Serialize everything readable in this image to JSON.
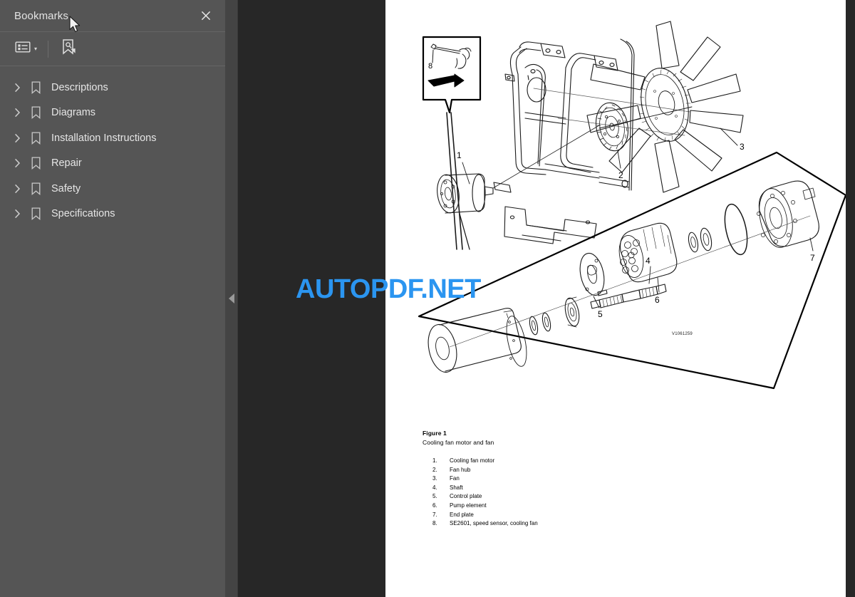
{
  "sidebar": {
    "title": "Bookmarks",
    "close_label": "×",
    "close_icon": "close-icon",
    "toolbar": {
      "list_options_icon": "list-options-icon",
      "list_options_caret": "▾",
      "find_bookmark_icon": "find-bookmark-icon"
    },
    "items": [
      {
        "label": "Descriptions",
        "chevron": "›",
        "icon": "bookmark-icon"
      },
      {
        "label": "Diagrams",
        "chevron": "›",
        "icon": "bookmark-icon"
      },
      {
        "label": "Installation Instructions",
        "chevron": "›",
        "icon": "bookmark-icon"
      },
      {
        "label": "Repair",
        "chevron": "›",
        "icon": "bookmark-icon"
      },
      {
        "label": "Safety",
        "chevron": "›",
        "icon": "bookmark-icon"
      },
      {
        "label": "Specifications",
        "chevron": "›",
        "icon": "bookmark-icon"
      }
    ]
  },
  "collapse_handle": {
    "icon": "collapse-left-triangle-icon"
  },
  "page": {
    "figure": {
      "title": "Figure 1",
      "subtitle": "Cooling fan motor and fan",
      "part_number": "V1061259",
      "callout_labels": [
        "1",
        "2",
        "3",
        "4",
        "5",
        "6",
        "7",
        "8"
      ],
      "legend": [
        {
          "num": "1.",
          "text": "Cooling fan motor"
        },
        {
          "num": "2.",
          "text": "Fan hub"
        },
        {
          "num": "3.",
          "text": "Fan"
        },
        {
          "num": "4.",
          "text": "Shaft"
        },
        {
          "num": "5.",
          "text": "Control plate"
        },
        {
          "num": "6.",
          "text": "Pump element"
        },
        {
          "num": "7.",
          "text": "End plate"
        },
        {
          "num": "8.",
          "text": "SE2601, speed sensor, cooling fan"
        }
      ]
    }
  },
  "watermark": {
    "text": "AUTOPDF.NET",
    "color": "#2b95f0"
  },
  "colors": {
    "sidebar_bg": "#555555",
    "viewer_bg": "#272727",
    "page_bg": "#ffffff",
    "strip_bg": "#444444",
    "text": "#e6e6e6"
  }
}
